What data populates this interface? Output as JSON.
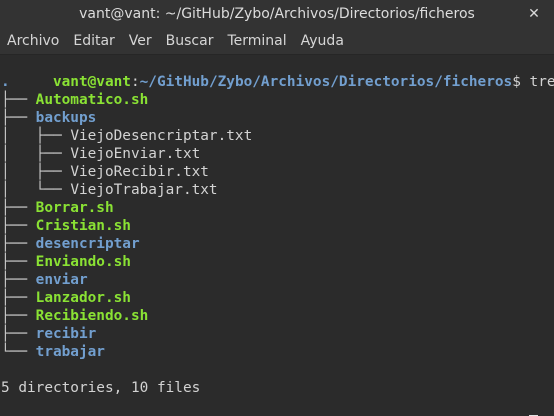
{
  "window": {
    "title": "vant@vant: ~/GitHub/Zybo/Archivos/Directorios/ficheros",
    "close_glyph": "✕"
  },
  "menubar": {
    "items": [
      "Archivo",
      "Editar",
      "Ver",
      "Buscar",
      "Terminal",
      "Ayuda"
    ]
  },
  "terminal": {
    "prompt_user": "vant@vant",
    "prompt_sep": ":",
    "prompt_path": "~/GitHub/Zybo/Archivos/Directorios/ficheros",
    "prompt_symbol": "$",
    "command": "tree",
    "root": ".",
    "entries": [
      {
        "branch": "├── ",
        "name": "Automatico.sh",
        "kind": "exec"
      },
      {
        "branch": "├── ",
        "name": "backups",
        "kind": "dir"
      },
      {
        "branch": "│   ├── ",
        "name": "ViejoDesencriptar.txt",
        "kind": "file"
      },
      {
        "branch": "│   ├── ",
        "name": "ViejoEnviar.txt",
        "kind": "file"
      },
      {
        "branch": "│   ├── ",
        "name": "ViejoRecibir.txt",
        "kind": "file"
      },
      {
        "branch": "│   └── ",
        "name": "ViejoTrabajar.txt",
        "kind": "file"
      },
      {
        "branch": "├── ",
        "name": "Borrar.sh",
        "kind": "exec"
      },
      {
        "branch": "├── ",
        "name": "Cristian.sh",
        "kind": "exec"
      },
      {
        "branch": "├── ",
        "name": "desencriptar",
        "kind": "dir"
      },
      {
        "branch": "├── ",
        "name": "Enviando.sh",
        "kind": "exec"
      },
      {
        "branch": "├── ",
        "name": "enviar",
        "kind": "dir"
      },
      {
        "branch": "├── ",
        "name": "Lanzador.sh",
        "kind": "exec"
      },
      {
        "branch": "├── ",
        "name": "Recibiendo.sh",
        "kind": "exec"
      },
      {
        "branch": "├── ",
        "name": "recibir",
        "kind": "dir"
      },
      {
        "branch": "└── ",
        "name": "trabajar",
        "kind": "dir"
      }
    ],
    "summary": "5 directories, 10 files"
  },
  "colors": {
    "background": "#2b2b2b",
    "titlebar": "#333333",
    "prompt_user": "#8ae234",
    "prompt_path": "#729fcf",
    "executable": "#8ae234",
    "directory": "#729fcf",
    "text": "#d3d3d3"
  }
}
